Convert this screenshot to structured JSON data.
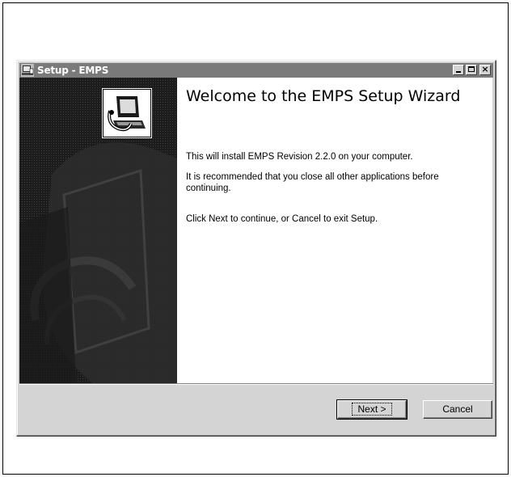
{
  "window": {
    "title": "Setup - EMPS",
    "controls": {
      "minimize": "minimize-icon",
      "maximize": "maximize-icon",
      "close": "close-icon"
    }
  },
  "wizard": {
    "heading": "Welcome to the EMPS Setup Wizard",
    "paragraphs": [
      "This will install EMPS Revision 2.2.0 on your computer.",
      "It is recommended that you close all other applications before continuing.",
      "Click Next to continue, or Cancel to exit Setup."
    ]
  },
  "buttons": {
    "next_label": "Next >",
    "cancel_label": "Cancel"
  },
  "colors": {
    "titlebar": "#7a7a7a",
    "side_panel": "#222222",
    "dialog_bg": "#d4d4d4"
  }
}
